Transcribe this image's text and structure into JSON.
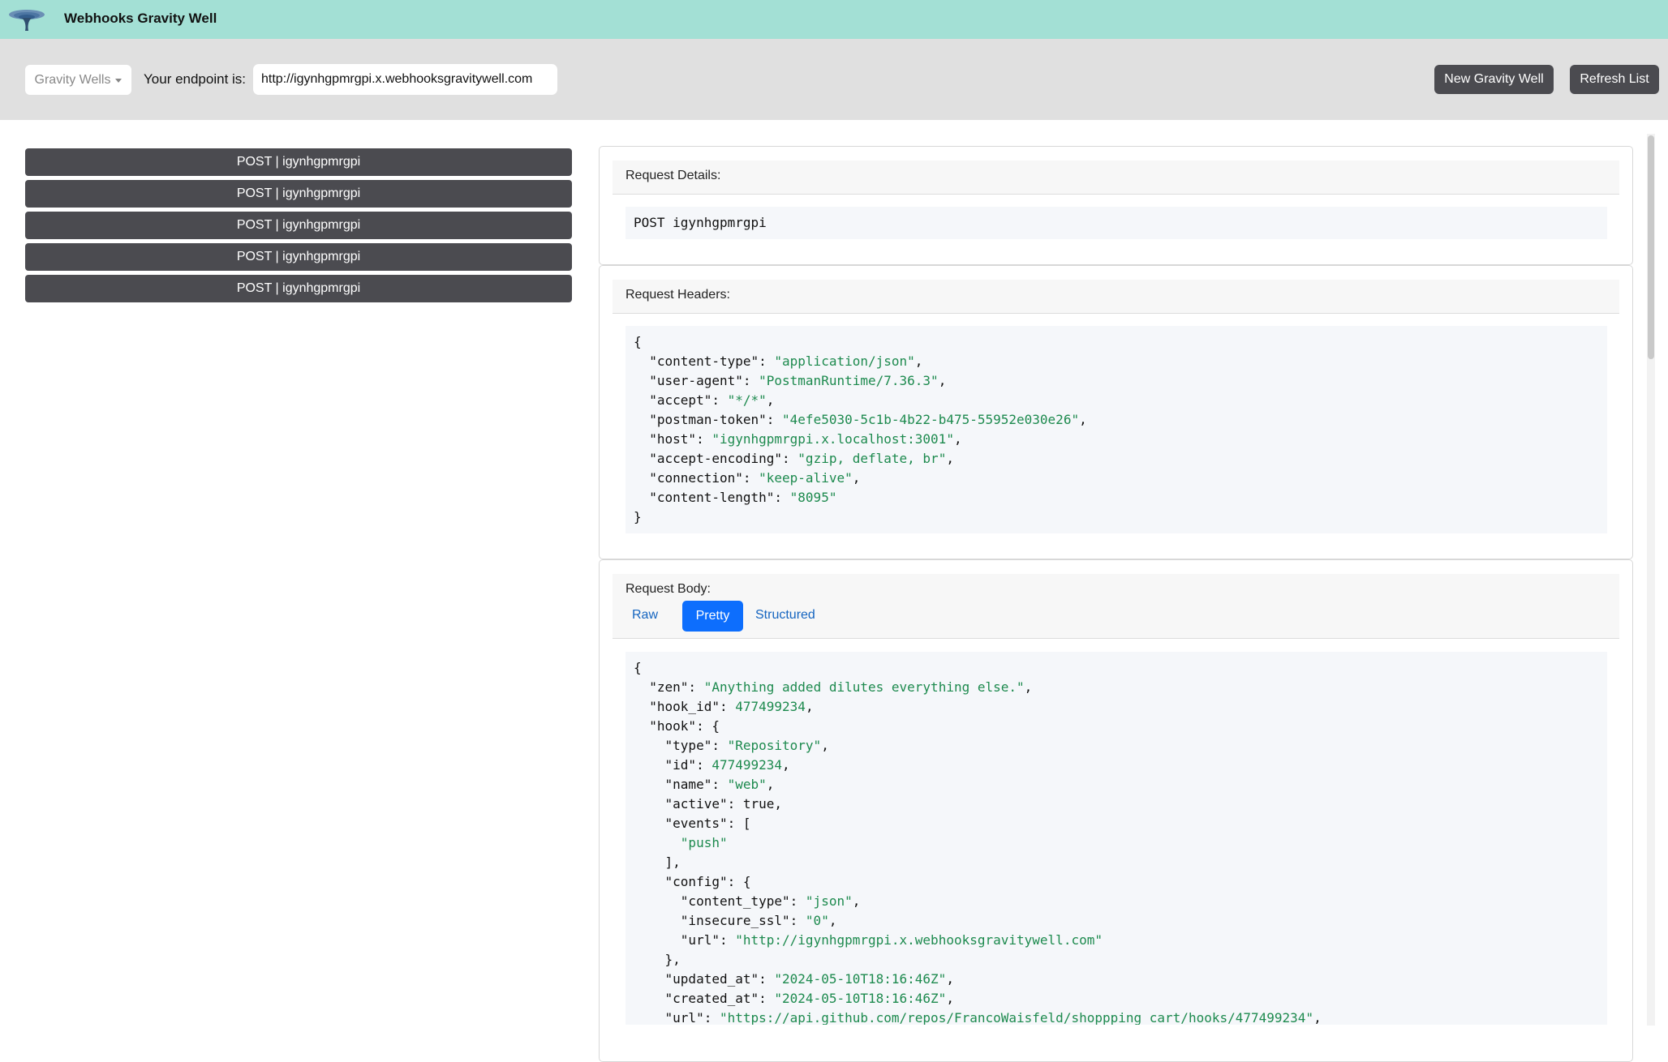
{
  "app": {
    "title": "Webhooks Gravity Well",
    "logo_icon": "gravity-well-logo-icon",
    "header_color": "#a3e0d5"
  },
  "toolbar": {
    "dropdown_label": "Gravity Wells",
    "endpoint_label": "Your endpoint is:",
    "endpoint_url": "http://igynhgpmrgpi.x.webhooksgravitywell.com",
    "new_button": "New Gravity Well",
    "refresh_button": "Refresh List"
  },
  "requests": [
    {
      "label": "POST | igynhgpmrgpi"
    },
    {
      "label": "POST | igynhgpmrgpi"
    },
    {
      "label": "POST | igynhgpmrgpi"
    },
    {
      "label": "POST | igynhgpmrgpi"
    },
    {
      "label": "POST | igynhgpmrgpi"
    }
  ],
  "details": {
    "title": "Request Details:",
    "line": "POST igynhgpmrgpi"
  },
  "headers": {
    "title": "Request Headers:",
    "entries": [
      [
        "content-type",
        "application/json"
      ],
      [
        "user-agent",
        "PostmanRuntime/7.36.3"
      ],
      [
        "accept",
        "*/*"
      ],
      [
        "postman-token",
        "4efe5030-5c1b-4b22-b475-55952e030e26"
      ],
      [
        "host",
        "igynhgpmrgpi.x.localhost:3001"
      ],
      [
        "accept-encoding",
        "gzip, deflate, br"
      ],
      [
        "connection",
        "keep-alive"
      ],
      [
        "content-length",
        "8095"
      ]
    ]
  },
  "body": {
    "title": "Request Body:",
    "tabs": [
      "Raw",
      "Pretty",
      "Structured"
    ],
    "active_tab": "Pretty",
    "active_color": "#0d6efd",
    "pretty_lines": [
      [
        {
          "t": "{"
        }
      ],
      [
        {
          "t": "  \"zen\": "
        },
        {
          "s": "\"Anything added dilutes everything else.\""
        },
        {
          "t": ","
        }
      ],
      [
        {
          "t": "  \"hook_id\": "
        },
        {
          "s": "477499234"
        },
        {
          "t": ","
        }
      ],
      [
        {
          "t": "  \"hook\": {"
        }
      ],
      [
        {
          "t": "    \"type\": "
        },
        {
          "s": "\"Repository\""
        },
        {
          "t": ","
        }
      ],
      [
        {
          "t": "    \"id\": "
        },
        {
          "s": "477499234"
        },
        {
          "t": ","
        }
      ],
      [
        {
          "t": "    \"name\": "
        },
        {
          "s": "\"web\""
        },
        {
          "t": ","
        }
      ],
      [
        {
          "t": "    \"active\": true,"
        }
      ],
      [
        {
          "t": "    \"events\": ["
        }
      ],
      [
        {
          "t": "      "
        },
        {
          "s": "\"push\""
        }
      ],
      [
        {
          "t": "    ],"
        }
      ],
      [
        {
          "t": "    \"config\": {"
        }
      ],
      [
        {
          "t": "      \"content_type\": "
        },
        {
          "s": "\"json\""
        },
        {
          "t": ","
        }
      ],
      [
        {
          "t": "      \"insecure_ssl\": "
        },
        {
          "s": "\"0\""
        },
        {
          "t": ","
        }
      ],
      [
        {
          "t": "      \"url\": "
        },
        {
          "s": "\"http://igynhgpmrgpi.x.webhooksgravitywell.com\""
        }
      ],
      [
        {
          "t": "    },"
        }
      ],
      [
        {
          "t": "    \"updated_at\": "
        },
        {
          "s": "\"2024-05-10T18:16:46Z\""
        },
        {
          "t": ","
        }
      ],
      [
        {
          "t": "    \"created_at\": "
        },
        {
          "s": "\"2024-05-10T18:16:46Z\""
        },
        {
          "t": ","
        }
      ],
      [
        {
          "t": "    \"url\": "
        },
        {
          "s": "\"https://api.github.com/repos/FrancoWaisfeld/shoppping_cart/hooks/477499234\""
        },
        {
          "t": ","
        }
      ]
    ]
  }
}
